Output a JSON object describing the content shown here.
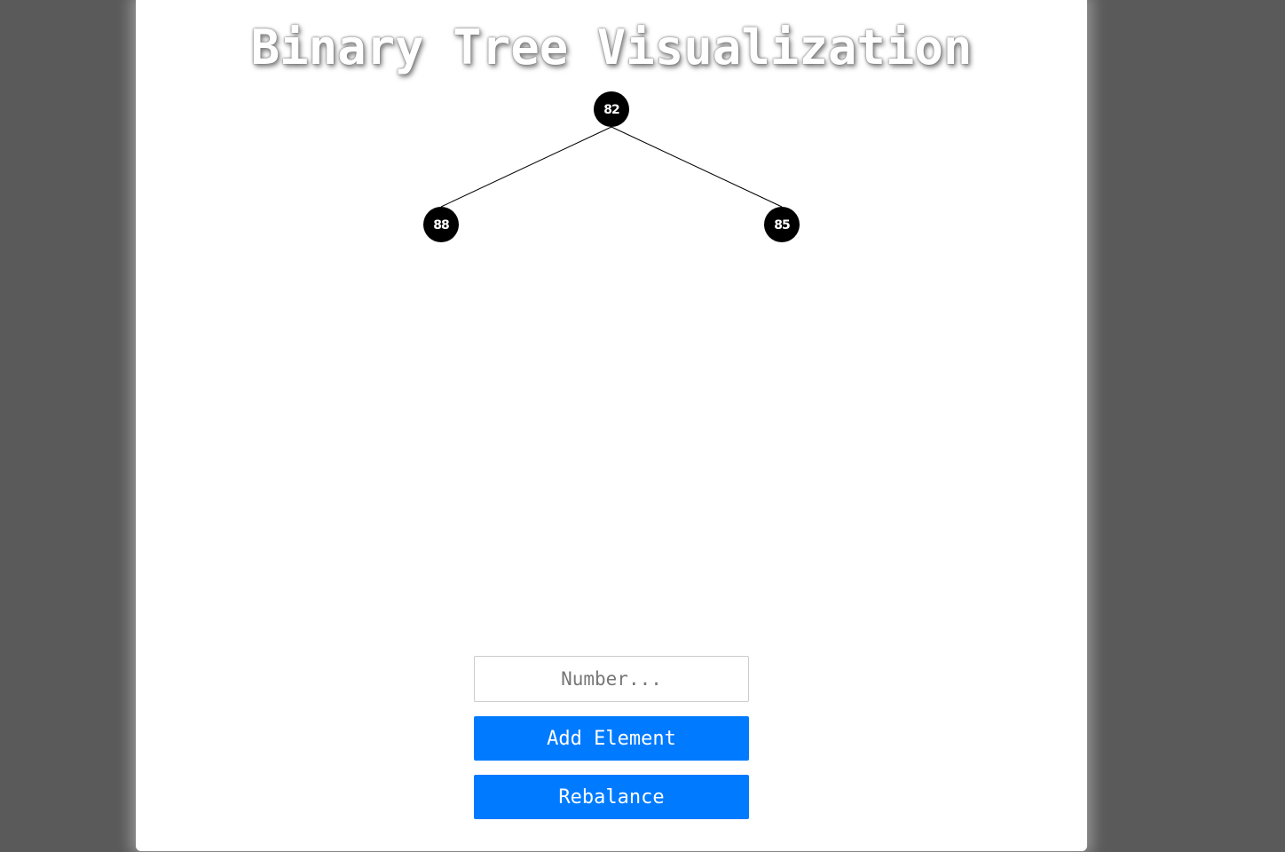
{
  "page": {
    "title": "Binary Tree Visualization"
  },
  "tree": {
    "root": {
      "value": "82"
    },
    "left": {
      "value": "88"
    },
    "right": {
      "value": "85"
    }
  },
  "controls": {
    "input_placeholder": "Number...",
    "input_value": "",
    "add_label": "Add Element",
    "rebalance_label": "Rebalance"
  },
  "colors": {
    "background": "#5a5a5a",
    "card": "#ffffff",
    "node_fill": "#000000",
    "button": "#007bff"
  }
}
